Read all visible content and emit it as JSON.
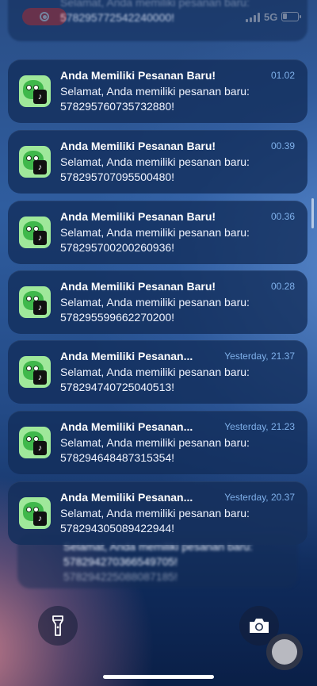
{
  "status_bar": {
    "network": "5G"
  },
  "top_partial": {
    "body_fragment": "Selamat, Anda memiliki pesanan baru:",
    "order": "578295772542240000!"
  },
  "notifications": [
    {
      "title": "Anda Memiliki Pesanan Baru!",
      "time": "01.02",
      "line1": "Selamat, Anda memiliki pesanan baru:",
      "line2": "578295760735732880!"
    },
    {
      "title": "Anda Memiliki Pesanan Baru!",
      "time": "00.39",
      "line1": "Selamat, Anda memiliki pesanan baru:",
      "line2": "578295707095500480!"
    },
    {
      "title": "Anda Memiliki Pesanan Baru!",
      "time": "00.36",
      "line1": "Selamat, Anda memiliki pesanan baru:",
      "line2": "578295700200260936!"
    },
    {
      "title": "Anda Memiliki Pesanan Baru!",
      "time": "00.28",
      "line1": "Selamat, Anda memiliki pesanan baru:",
      "line2": "578295599662270200!"
    },
    {
      "title": "Anda Memiliki Pesanan...",
      "time": "Yesterday, 21.37",
      "line1": "Selamat, Anda memiliki pesanan baru:",
      "line2": "578294740725040513!"
    },
    {
      "title": "Anda Memiliki Pesanan...",
      "time": "Yesterday, 21.23",
      "line1": "Selamat, Anda memiliki pesanan baru:",
      "line2": "578294648487315354!"
    },
    {
      "title": "Anda Memiliki Pesanan...",
      "time": "Yesterday, 20.37",
      "line1": "Selamat, Anda memiliki pesanan baru:",
      "line2": "578294305089422944!"
    }
  ],
  "stacked": {
    "line1": "Selamat, Anda memiliki pesanan baru:",
    "line2": "578294270366549705!",
    "line3": "578294225088087185!"
  },
  "icons": {
    "app": "tiktok-shop-icon",
    "flashlight": "flashlight-icon",
    "camera": "camera-icon",
    "assistive": "assistive-touch-icon"
  }
}
